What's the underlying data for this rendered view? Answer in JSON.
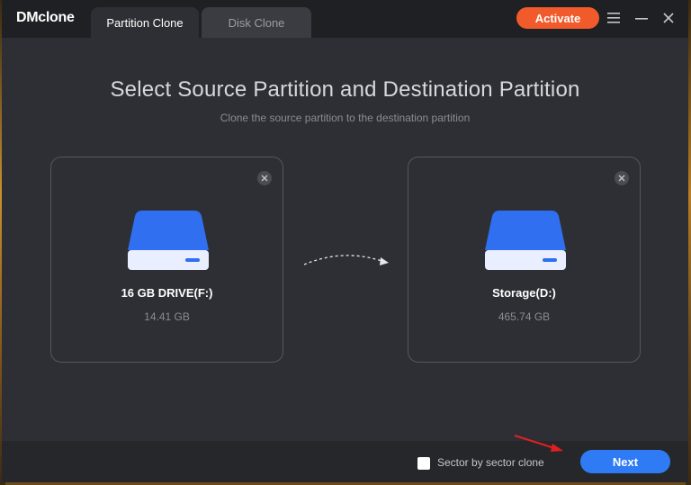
{
  "app": {
    "brand": "DMclone"
  },
  "tabs": [
    {
      "label": "Partition Clone",
      "active": true
    },
    {
      "label": "Disk Clone",
      "active": false
    }
  ],
  "header": {
    "activate_label": "Activate",
    "menu_icon": "hamburger-menu-icon",
    "minimize_icon": "minimize-icon",
    "close_icon": "close-icon"
  },
  "main": {
    "title": "Select Source Partition and Destination Partition",
    "subtitle": "Clone the source partition to the destination partition"
  },
  "source": {
    "name": "16 GB DRIVE(F:)",
    "size": "14.41 GB",
    "icon": "drive-icon"
  },
  "destination": {
    "name": "Storage(D:)",
    "size": "465.74 GB",
    "icon": "drive-icon"
  },
  "footer": {
    "sector_label": "Sector by sector clone",
    "sector_checked": false,
    "next_label": "Next"
  },
  "colors": {
    "accent": "#2f7bf5",
    "activate": "#f15a2b",
    "window_bg": "#2e2f34",
    "titlebar_bg": "#1f2024",
    "annotation_arrow": "#e02020"
  }
}
